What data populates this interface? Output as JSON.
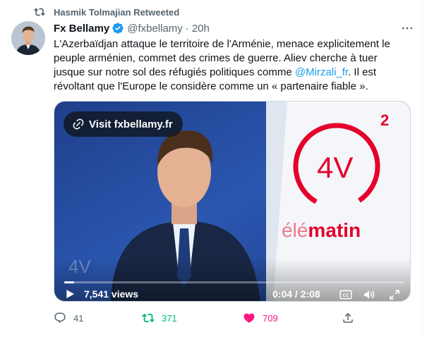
{
  "retweet_context": {
    "text": "Hasmik Tolmajian Retweeted"
  },
  "tweet": {
    "author_name": "Fx Bellamy",
    "handle": "@fxbellamy",
    "separator": "·",
    "time": "20h",
    "text_part1": "L'Azerbaïdjan attaque le territoire de l'Arménie, menace explicitement le peuple arménien, commet des crimes de guerre. Aliev cherche à tuer jusque sur notre sol des réfugiés politiques comme ",
    "mention": "@Mirzali_fr",
    "text_part2": ". Il est révoltant que l'Europe le considère comme un « partenaire fiable »."
  },
  "media": {
    "visit_label": "Visit fxbellamy.fr",
    "views": "7,541 views",
    "time_display": "0:04 / 2:08",
    "progress_fraction": 0.03,
    "channel_logo": "2",
    "show_logo": "4V",
    "show_name_prefix": "élé",
    "show_name_suffix": "matin"
  },
  "actions": {
    "replies": "41",
    "retweets": "371",
    "likes": "709"
  },
  "colors": {
    "link": "#1d9bf0",
    "retweet_active": "#00ba7c",
    "like_active": "#f91880",
    "secondary_text": "#536471",
    "brand_red": "#e4002b"
  },
  "icons": [
    "retweet-icon",
    "verified-badge-icon",
    "more-icon",
    "link-icon",
    "play-icon",
    "captions-icon",
    "volume-icon",
    "fullscreen-icon",
    "reply-icon",
    "heart-icon",
    "share-icon"
  ]
}
